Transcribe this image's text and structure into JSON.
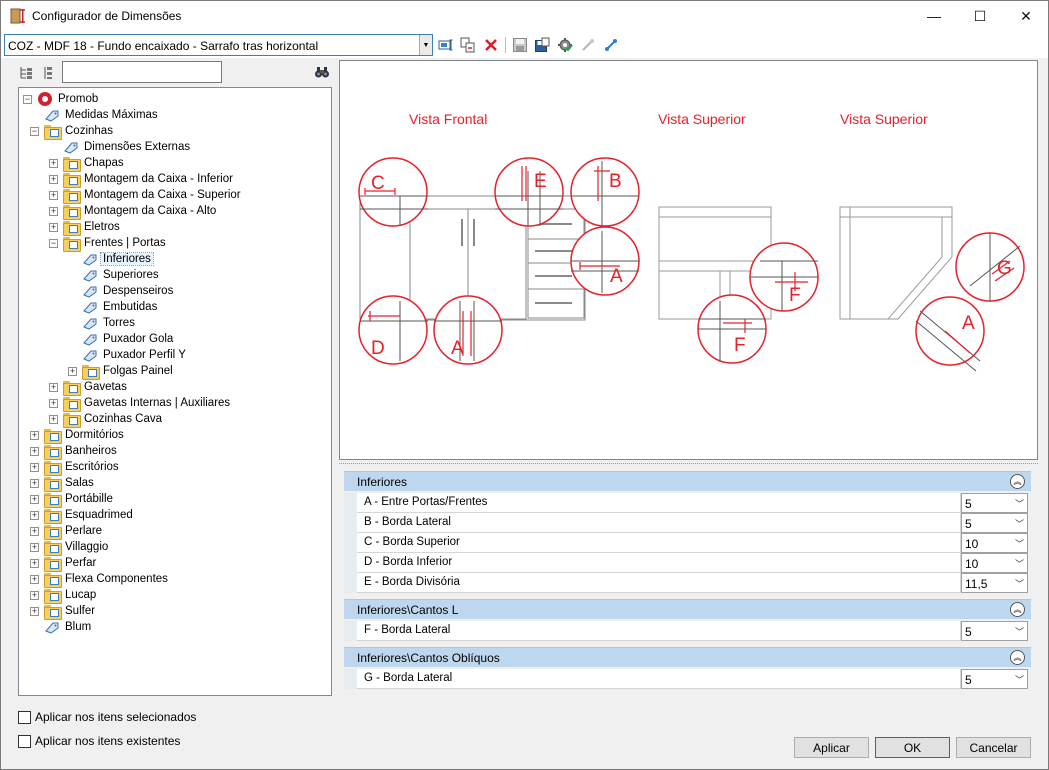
{
  "window": {
    "title": "Configurador de Dimensões",
    "controls": {
      "minimize": "—",
      "maximize": "☐",
      "close": "✕"
    }
  },
  "toolbar": {
    "selected_config": "COZ - MDF 18 - Fundo encaixado - Sarrafo tras horizontal",
    "icons": [
      "rename-icon",
      "copy-icon",
      "delete-icon",
      "save-icon",
      "save-as-icon",
      "gear-icon",
      "import-icon",
      "export-icon"
    ]
  },
  "search": {
    "value": "",
    "placeholder": ""
  },
  "tree": {
    "nodes": [
      {
        "label": "Promob",
        "level": 0,
        "icon": "promob-logo-icon",
        "exp": "-"
      },
      {
        "label": "Medidas Máximas",
        "level": 1,
        "icon": "tag",
        "exp": ""
      },
      {
        "label": "Cozinhas",
        "level": 1,
        "icon": "folder",
        "exp": "-"
      },
      {
        "label": "Dimensões Externas",
        "level": 2,
        "icon": "tag",
        "exp": ""
      },
      {
        "label": "Chapas",
        "level": 2,
        "icon": "folder",
        "exp": "+"
      },
      {
        "label": "Montagem da Caixa - Inferior",
        "level": 2,
        "icon": "folder",
        "exp": "+"
      },
      {
        "label": "Montagem da Caixa - Superior",
        "level": 2,
        "icon": "folder",
        "exp": "+"
      },
      {
        "label": "Montagem da Caixa - Alto",
        "level": 2,
        "icon": "folder",
        "exp": "+"
      },
      {
        "label": "Eletros",
        "level": 2,
        "icon": "folder",
        "exp": "+"
      },
      {
        "label": "Frentes | Portas",
        "level": 2,
        "icon": "folder",
        "exp": "-"
      },
      {
        "label": "Inferiores",
        "level": 3,
        "icon": "tag",
        "exp": "",
        "selected": true
      },
      {
        "label": "Superiores",
        "level": 3,
        "icon": "tag",
        "exp": ""
      },
      {
        "label": "Despenseiros",
        "level": 3,
        "icon": "tag",
        "exp": ""
      },
      {
        "label": "Embutidas",
        "level": 3,
        "icon": "tag",
        "exp": ""
      },
      {
        "label": "Torres",
        "level": 3,
        "icon": "tag",
        "exp": ""
      },
      {
        "label": "Puxador Gola",
        "level": 3,
        "icon": "tag",
        "exp": ""
      },
      {
        "label": "Puxador Perfil Y",
        "level": 3,
        "icon": "tag",
        "exp": ""
      },
      {
        "label": "Folgas Painel",
        "level": 3,
        "icon": "folder",
        "exp": "+"
      },
      {
        "label": "Gavetas",
        "level": 2,
        "icon": "folder",
        "exp": "+"
      },
      {
        "label": "Gavetas Internas | Auxiliares",
        "level": 2,
        "icon": "folder",
        "exp": "+"
      },
      {
        "label": "Cozinhas Cava",
        "level": 2,
        "icon": "folder",
        "exp": "+"
      },
      {
        "label": "Dormitórios",
        "level": 1,
        "icon": "folder",
        "exp": "+"
      },
      {
        "label": "Banheiros",
        "level": 1,
        "icon": "folder",
        "exp": "+"
      },
      {
        "label": "Escritórios",
        "level": 1,
        "icon": "folder",
        "exp": "+"
      },
      {
        "label": "Salas",
        "level": 1,
        "icon": "folder",
        "exp": "+"
      },
      {
        "label": "Portábille",
        "level": 1,
        "icon": "folder",
        "exp": "+"
      },
      {
        "label": "Esquadrimed",
        "level": 1,
        "icon": "folder",
        "exp": "+"
      },
      {
        "label": "Perlare",
        "level": 1,
        "icon": "folder",
        "exp": "+"
      },
      {
        "label": "Villaggio",
        "level": 1,
        "icon": "folder",
        "exp": "+"
      },
      {
        "label": "Perfar",
        "level": 1,
        "icon": "folder",
        "exp": "+"
      },
      {
        "label": "Flexa Componentes",
        "level": 1,
        "icon": "folder",
        "exp": "+"
      },
      {
        "label": "Lucap",
        "level": 1,
        "icon": "folder",
        "exp": "+"
      },
      {
        "label": "Sulfer",
        "level": 1,
        "icon": "folder",
        "exp": "+"
      },
      {
        "label": "Blum",
        "level": 1,
        "icon": "tag",
        "exp": ""
      }
    ]
  },
  "options": {
    "apply_selected": "Aplicar nos itens selecionados",
    "apply_existing": "Aplicar nos itens existentes"
  },
  "preview": {
    "view_front": "Vista Frontal",
    "view_top_1": "Vista Superior",
    "view_top_2": "Vista Superior",
    "accent": "#e8202a",
    "markers": {
      "a": "A",
      "b": "B",
      "c": "C",
      "d": "D",
      "e": "E",
      "f": "F",
      "g": "G"
    }
  },
  "properties": {
    "cat1": {
      "title": "Inferiores",
      "rows": [
        {
          "name": "A - Entre Portas/Frentes",
          "value": "5"
        },
        {
          "name": "B - Borda Lateral",
          "value": "5"
        },
        {
          "name": "C - Borda Superior",
          "value": "10"
        },
        {
          "name": "D - Borda Inferior",
          "value": "10"
        },
        {
          "name": "E - Borda Divisória",
          "value": "11,5"
        }
      ]
    },
    "cat2": {
      "title": "Inferiores\\Cantos L",
      "rows": [
        {
          "name": "F - Borda Lateral",
          "value": "5"
        }
      ]
    },
    "cat3": {
      "title": "Inferiores\\Cantos Oblíquos",
      "rows": [
        {
          "name": "G - Borda Lateral",
          "value": "5"
        }
      ]
    }
  },
  "buttons": {
    "apply": "Aplicar",
    "ok": "OK",
    "cancel": "Cancelar"
  }
}
